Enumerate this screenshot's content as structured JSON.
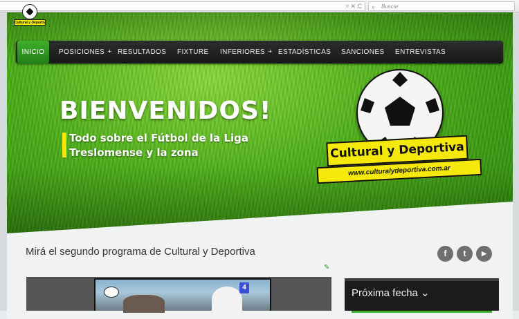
{
  "browser": {
    "search_placeholder": "Buscar"
  },
  "site": {
    "logo_text": "Cultural y Deportiva"
  },
  "nav": {
    "items": [
      {
        "label": "INICIO",
        "has_submenu": false,
        "active": true
      },
      {
        "label": "POSICIONES",
        "has_submenu": true,
        "active": false
      },
      {
        "label": "RESULTADOS",
        "has_submenu": false,
        "active": false
      },
      {
        "label": "FIXTURE",
        "has_submenu": false,
        "active": false
      },
      {
        "label": "INFERIORES",
        "has_submenu": true,
        "active": false
      },
      {
        "label": "ESTADÍSTICAS",
        "has_submenu": false,
        "active": false
      },
      {
        "label": "SANCIONES",
        "has_submenu": false,
        "active": false
      },
      {
        "label": "ENTREVISTAS",
        "has_submenu": false,
        "active": false
      }
    ],
    "submenu_marker": "+"
  },
  "hero": {
    "welcome": "BIENVENIDOS!",
    "subtitle_line1": "Todo sobre el Fútbol de la Liga",
    "subtitle_line2": "Treslomense y la zona",
    "brand": "Cultural y Deportiva",
    "url": "www.culturalydeportiva.com.ar"
  },
  "post": {
    "title": "Mirá el segundo programa de Cultural y Deportiva",
    "video_badge": "4"
  },
  "social": {
    "facebook_glyph": "f",
    "twitter_glyph": "t",
    "youtube_glyph": "▶"
  },
  "sidebar": {
    "widget_title": "Próxima fecha",
    "widget_chevron": "⌄"
  },
  "colors": {
    "nav_active": "#3fae2a",
    "banner_yellow": "#f5e90c",
    "grass": "#4fb21a"
  }
}
